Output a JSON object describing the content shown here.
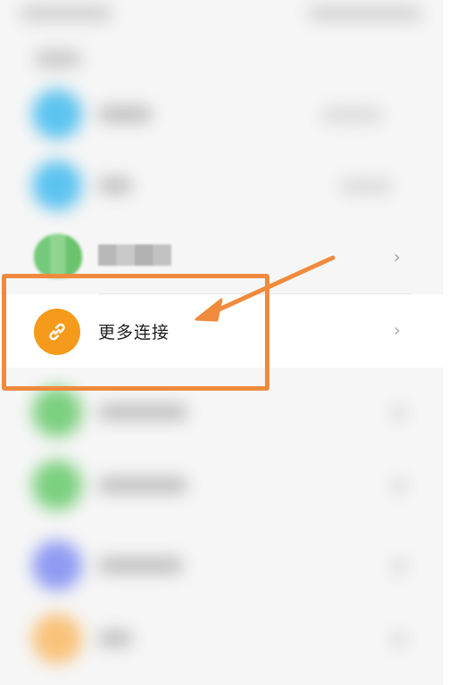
{
  "more_connections": {
    "label": "更多连接",
    "icon": "link-icon",
    "chevron": "›"
  },
  "colors": {
    "highlight": "#f08a3c",
    "more_icon_bg": "#f59a1b",
    "avatar_blue": "#5cc3f0",
    "avatar_green": "#7bd07e",
    "avatar_purple": "#8f9bf3",
    "avatar_orange": "#f9c27a"
  }
}
